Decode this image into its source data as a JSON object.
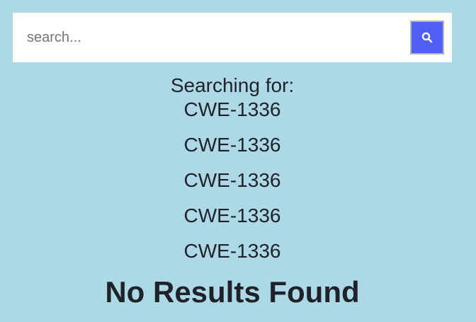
{
  "search": {
    "placeholder": "search...",
    "value": "",
    "button_icon": "search-icon"
  },
  "results": {
    "searching_label": "Searching for:",
    "queries": [
      "CWE-1336",
      "CWE-1336",
      "CWE-1336",
      "CWE-1336",
      "CWE-1336"
    ],
    "empty_message": "No Results Found"
  },
  "colors": {
    "background": "#add8e6",
    "search_button": "#4f5ef7",
    "text": "#1f2329"
  }
}
